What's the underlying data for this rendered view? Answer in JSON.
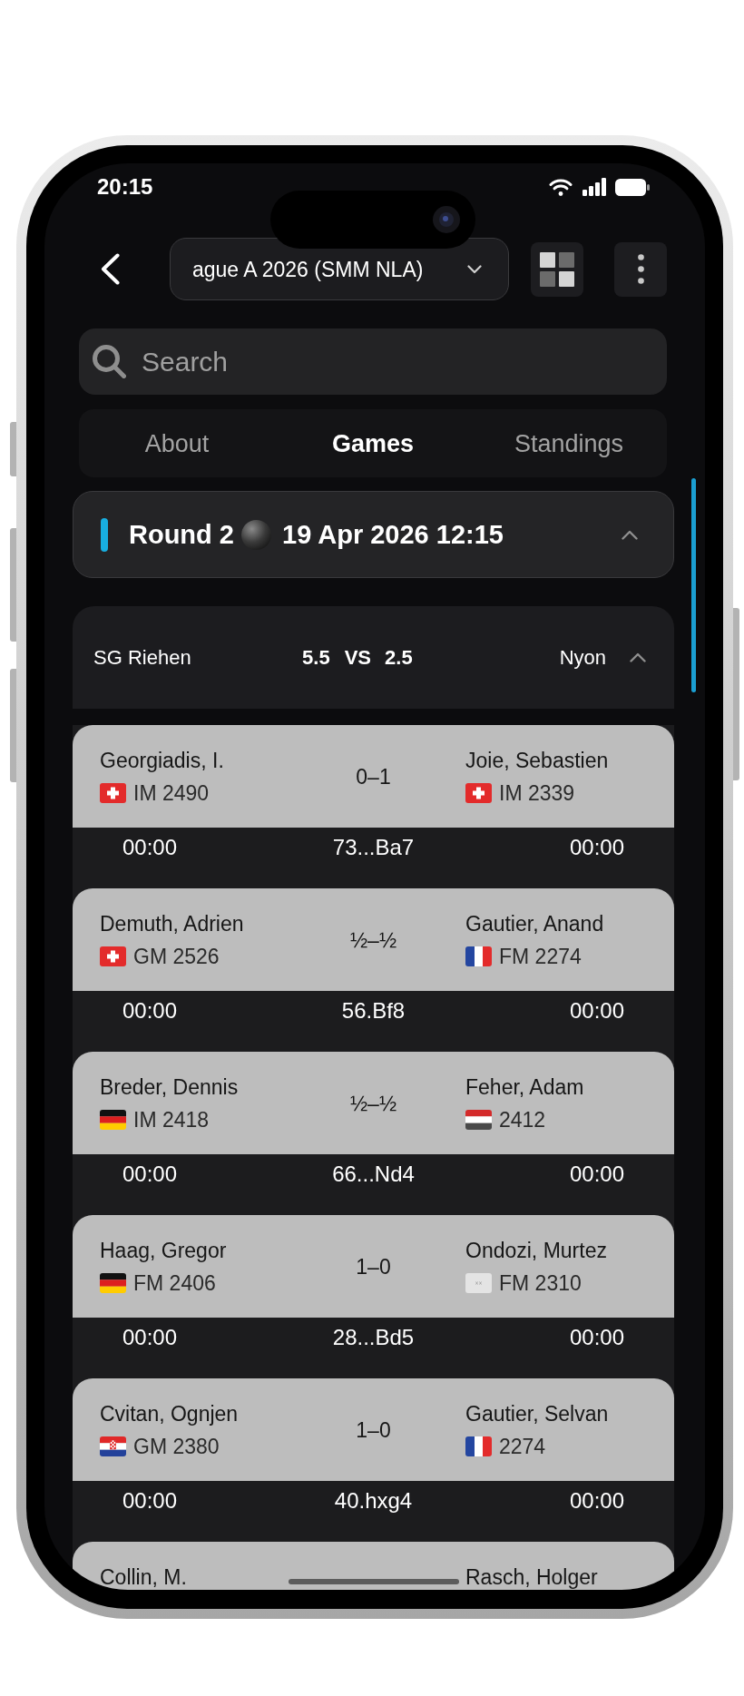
{
  "status_bar": {
    "time": "20:15"
  },
  "header": {
    "tournament": "ague A 2026 (SMM NLA)"
  },
  "search": {
    "placeholder": "Search"
  },
  "tabs": [
    {
      "label": "About",
      "selected": false
    },
    {
      "label": "Games",
      "selected": true
    },
    {
      "label": "Standings",
      "selected": false
    }
  ],
  "round": {
    "label": "Round 2",
    "date": "19 Apr 2026 12:15",
    "expanded": true
  },
  "match": {
    "home_team": "SG Riehen",
    "home_score": "5.5",
    "vs_label": "VS",
    "away_score": "2.5",
    "away_team": "Nyon",
    "expanded": true,
    "games": [
      {
        "white": {
          "name": "Georgiadis, I.",
          "flag": {
            "kind": "swiss"
          },
          "rating": "IM 2490"
        },
        "result": "0–1",
        "black": {
          "name": "Joie, Sebastien",
          "flag": {
            "kind": "swiss"
          },
          "rating": "IM 2339"
        },
        "white_clock": "00:00",
        "last_move": "73...Ba7",
        "black_clock": "00:00"
      },
      {
        "white": {
          "name": "Demuth, Adrien",
          "flag": {
            "kind": "swiss"
          },
          "rating": "GM 2526"
        },
        "result": "½–½",
        "black": {
          "name": "Gautier, Anand",
          "flag": {
            "kind": "french"
          },
          "rating": "FM 2274"
        },
        "white_clock": "00:00",
        "last_move": "56.Bf8",
        "black_clock": "00:00"
      },
      {
        "white": {
          "name": "Breder, Dennis",
          "flag": {
            "kind": "german"
          },
          "rating": "IM 2418"
        },
        "result": "½–½",
        "black": {
          "name": "Feher, Adam",
          "flag": {
            "kind": "yemeni"
          },
          "rating": "2412"
        },
        "white_clock": "00:00",
        "last_move": "66...Nd4",
        "black_clock": "00:00"
      },
      {
        "white": {
          "name": "Haag, Gregor",
          "flag": {
            "kind": "german"
          },
          "rating": "FM 2406"
        },
        "result": "1–0",
        "black": {
          "name": "Ondozi, Murtez",
          "flag": {
            "kind": "placeholder"
          },
          "rating": "FM 2310"
        },
        "white_clock": "00:00",
        "last_move": "28...Bd5",
        "black_clock": "00:00"
      },
      {
        "white": {
          "name": "Cvitan, Ognjen",
          "flag": {
            "kind": "croatian"
          },
          "rating": "GM 2380"
        },
        "result": "1–0",
        "black": {
          "name": "Gautier, Selvan",
          "flag": {
            "kind": "french"
          },
          "rating": "2274"
        },
        "white_clock": "00:00",
        "last_move": "40.hxg4",
        "black_clock": "00:00"
      },
      {
        "white": {
          "name": "Collin, M."
        },
        "black": {
          "name": "Rasch, Holger"
        }
      }
    ]
  }
}
